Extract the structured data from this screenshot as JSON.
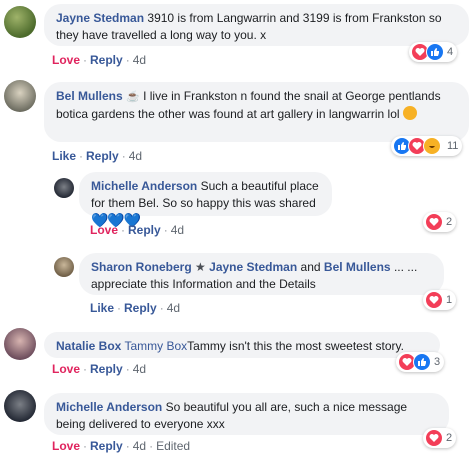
{
  "comments": [
    {
      "name": "Jayne Stedman",
      "text": "3910 is from Langwarrin and 3199 is from Frankston so they have travelled a long way to you. x",
      "action": "Love",
      "reply": "Reply",
      "time": "4d",
      "reactions": "4"
    },
    {
      "name": "Bel Mullens",
      "text": "I live in Frankston n found the snail at George pentlands botica gardens the other was found at art gallery in langwarrin lol",
      "action": "Like",
      "reply": "Reply",
      "time": "4d",
      "reactions": "11"
    },
    {
      "name": "Michelle Anderson",
      "text": "Such a beautiful place for them Bel. So so happy this was shared",
      "action": "Love",
      "reply": "Reply",
      "time": "4d",
      "reactions": "2"
    },
    {
      "name": "Sharon Roneberg",
      "tag1": "Jayne Stedman",
      "and": "and",
      "tag2": "Bel Mullens",
      "text1": "... ...",
      "text2": "appreciate this Information and the Details",
      "action": "Like",
      "reply": "Reply",
      "time": "4d",
      "reactions": "1"
    },
    {
      "name": "Natalie Box",
      "tag": "Tammy Box",
      "text": "Tammy isn't this the most sweetest story.",
      "action": "Love",
      "reply": "Reply",
      "time": "4d",
      "reactions": "3"
    },
    {
      "name": "Michelle Anderson",
      "text": "So beautiful you all are, such a nice message being delivered to everyone xxx",
      "action": "Love",
      "reply": "Reply",
      "time": "4d",
      "edited": "Edited",
      "reactions": "2"
    }
  ],
  "colors": {
    "link": "#385898",
    "love": "#e0245e",
    "bubble": "#f2f3f5",
    "heart": "#f33e58",
    "like": "#1877f2"
  }
}
